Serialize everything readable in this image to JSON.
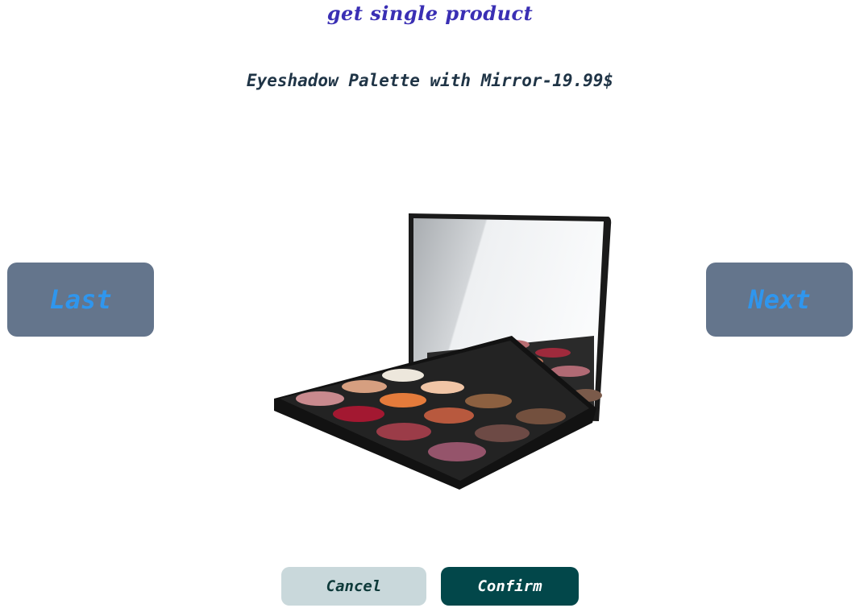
{
  "header": {
    "title": "get single product"
  },
  "product": {
    "name_price": "Eyeshadow Palette with Mirror-19.99$",
    "image": "eyeshadow-palette-image"
  },
  "navigation": {
    "last_label": "Last",
    "next_label": "Next"
  },
  "actions": {
    "cancel_label": "Cancel",
    "confirm_label": "Confirm"
  },
  "colors": {
    "title": "#3a2fb4",
    "product_text": "#1f3446",
    "nav_button_bg": "#64758c",
    "nav_button_text": "#2f96ee",
    "cancel_bg": "#c9d8db",
    "confirm_bg": "#02474a"
  }
}
